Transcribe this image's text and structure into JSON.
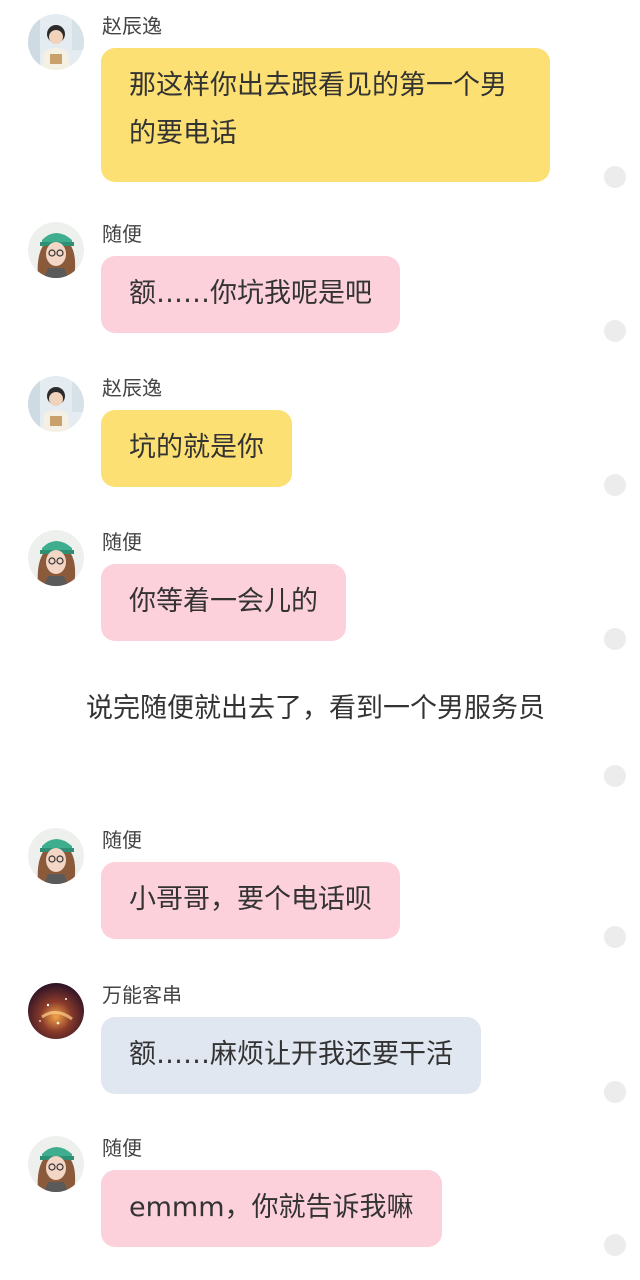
{
  "colors": {
    "bubble_zhao": "#fde073",
    "bubble_suibian": "#fdd1dc",
    "bubble_wanneng": "#e1e7f0",
    "dot": "#ececec",
    "text": "#333333"
  },
  "messages": [
    {
      "sender": "赵辰逸",
      "avatar": "boy-avatar-icon",
      "text": "那这样你出去跟看见的第一个男的要电话"
    },
    {
      "sender": "随便",
      "avatar": "girl-avatar-icon",
      "text": "额……你坑我呢是吧"
    },
    {
      "sender": "赵辰逸",
      "avatar": "boy-avatar-icon",
      "text": "坑的就是你"
    },
    {
      "sender": "随便",
      "avatar": "girl-avatar-icon",
      "text": "你等着一会儿的"
    },
    {
      "sender": "随便",
      "avatar": "girl-avatar-icon",
      "text": "小哥哥，要个电话呗"
    },
    {
      "sender": "万能客串",
      "avatar": "galaxy-avatar-icon",
      "text": "额……麻烦让开我还要干活"
    },
    {
      "sender": "随便",
      "avatar": "girl-avatar-icon",
      "text": "emmm，你就告诉我嘛"
    }
  ],
  "narration": "说完随便就出去了，看到一个男服务员"
}
